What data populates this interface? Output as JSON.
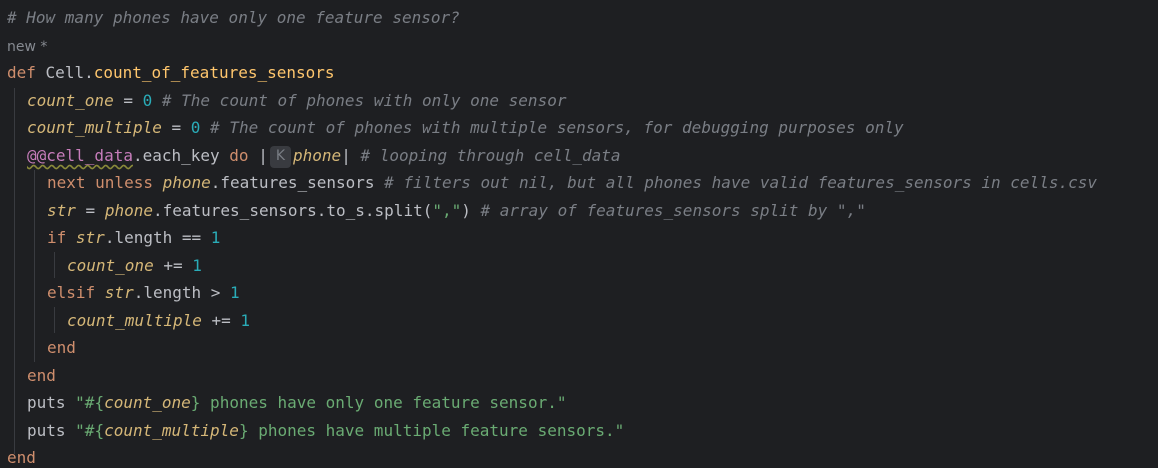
{
  "editor": {
    "top_comment": "# How many phones have only one feature sensor?",
    "usage_hint": "new *",
    "def_kw": "def",
    "class_name": "Cell",
    "method_name": "count_of_features_sensors",
    "count_one_var": "count_one",
    "count_one_init": " = ",
    "count_one_zero": "0",
    "count_one_comment": " # The count of phones with only one sensor",
    "count_multiple_var": "count_multiple",
    "count_multiple_init": " = ",
    "count_multiple_zero": "0",
    "count_multiple_comment": " # The count of phones with multiple sensors, for debugging purposes only",
    "class_var": "@@cell_data",
    "each_key": ".each_key ",
    "do_kw": "do",
    "pipe_open": " |",
    "param_hint": "K",
    "param": "phone",
    "pipe_close": "| ",
    "loop_comment": "# looping through cell_data",
    "next_kw": "next unless ",
    "phone_ref1": "phone",
    "features_sensors_call": ".features_sensors ",
    "next_comment": "# filters out nil, but all phones have valid features_sensors in cells.csv",
    "str_var": "str",
    "str_assign": " = ",
    "phone_ref2": "phone",
    "split_call": ".features_sensors.to_s.split(",
    "split_arg": "\",\"",
    "split_close": ") ",
    "split_comment": "# array of features_sensors split by \",\"",
    "if_kw": "if ",
    "str_ref1": "str",
    "if_cond": ".length == ",
    "if_num": "1",
    "inc_one_var": "count_one",
    "inc_one_op": " += ",
    "inc_one_num": "1",
    "elsif_kw": "elsif ",
    "str_ref2": "str",
    "elsif_cond": ".length > ",
    "elsif_num": "1",
    "inc_multi_var": "count_multiple",
    "inc_multi_op": " += ",
    "inc_multi_num": "1",
    "end_if": "end",
    "end_do": "end",
    "puts1_kw": "puts ",
    "puts1_open": "\"#{",
    "puts1_var": "count_one",
    "puts1_close": "}",
    "puts1_text": " phones have only one feature sensor.\"",
    "puts2_kw": "puts ",
    "puts2_open": "\"#{",
    "puts2_var": "count_multiple",
    "puts2_close": "}",
    "puts2_text": " phones have multiple feature sensors.\"",
    "end_def": "end"
  },
  "colors": {
    "background": "#1e1f22",
    "comment": "#7a7e85",
    "keyword": "#cf8e6d",
    "number": "#2aacb8",
    "local_variable": "#d5b778",
    "method": "#ffc66d",
    "string": "#6aab73",
    "class_variable": "#c77dbb",
    "default_text": "#bcbec4"
  }
}
